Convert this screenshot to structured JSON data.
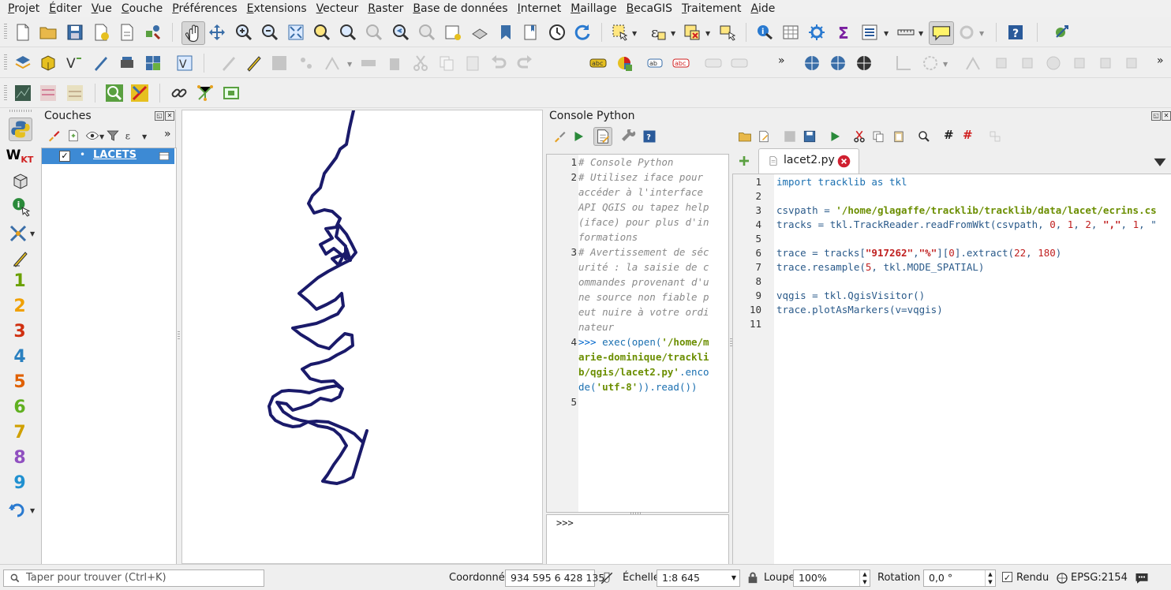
{
  "menubar": {
    "items": [
      {
        "label": "Projet",
        "accel": "P",
        "rest": "rojet"
      },
      {
        "label": "Éditer",
        "accel": "É",
        "rest": "diter"
      },
      {
        "label": "Vue",
        "accel": "V",
        "rest": "ue"
      },
      {
        "label": "Couche",
        "accel": "C",
        "rest": "ouche"
      },
      {
        "label": "Préférences",
        "accel": "P",
        "rest": "références"
      },
      {
        "label": "Extensions",
        "accel": "E",
        "rest": "xtensions"
      },
      {
        "label": "Vecteur",
        "accel": "V",
        "rest": "ecteur"
      },
      {
        "label": "Raster",
        "accel": "R",
        "rest": "aster"
      },
      {
        "label": "Base de données",
        "accel": "B",
        "rest": "ase de données"
      },
      {
        "label": "Internet",
        "accel": "I",
        "rest": "nternet"
      },
      {
        "label": "Maillage",
        "accel": "M",
        "rest": "aillage"
      },
      {
        "label": "BecaGIS",
        "accel": "B",
        "rest": "ecaGIS"
      },
      {
        "label": "Traitement",
        "accel": "T",
        "rest": "raitement"
      },
      {
        "label": "Aide",
        "accel": "A",
        "rest": "ide"
      }
    ]
  },
  "layers_panel": {
    "title": "Couches",
    "layer_name": "LACETS",
    "layer_checked": "✓",
    "layer_bullet": "•"
  },
  "left_toolbar": {
    "numbers": [
      "1",
      "2",
      "3",
      "4",
      "5",
      "6",
      "7",
      "8",
      "9"
    ],
    "number_colors": [
      "#6aa000",
      "#f0a000",
      "#d03010",
      "#2a80c0",
      "#e06000",
      "#60b020",
      "#d0a000",
      "#9050c0",
      "#2090d0"
    ],
    "wkt_label": "W"
  },
  "console": {
    "title": "Console Python",
    "lines": [
      {
        "n": "1",
        "text": "# Console Python"
      },
      {
        "n": "2",
        "text": "# Utilisez iface pour accéder à l'interface API QGIS ou tapez help(iface) pour plus d'informations"
      },
      {
        "n": "3",
        "text": "# Avertissement de sécurité : la saisie de commandes provenant d'une source non fiable peut nuire à votre ordinateur"
      },
      {
        "n": "4",
        "prompt": ">>>",
        "call": "exec(open(",
        "path": "'/home/marie-dominique/tracklib/qgis/lacet2.py'",
        "tail1": ".encode(",
        "enc": "'utf-8'",
        "tail2": ")).read())"
      },
      {
        "n": "5",
        "text": ""
      }
    ],
    "wrapped": {
      "l1": [
        "# Console Python"
      ],
      "l2": [
        "# Utilisez iface pour",
        "accéder à l'interface",
        "API QGIS ou tapez help",
        "(iface) pour plus d'in",
        "formations"
      ],
      "l3": [
        "# Avertissement de séc",
        "urité : la saisie de c",
        "ommandes provenant d'u",
        "ne source non fiable p",
        "eut nuire à votre ordi",
        "nateur"
      ],
      "l4a": ">>> ",
      "l4b": "exec(open(",
      "l4c": "'/home/m",
      "l4d": "arie-dominique/trackli",
      "l4e": "b/qgis/lacet2.py'",
      "l4f": ".enco",
      "l4g": "de(",
      "l4h": "'utf-8'",
      "l4i": ")).read())"
    },
    "input_prompt": ">>>"
  },
  "editor": {
    "tab_label": "lacet2.py",
    "lines": [
      {
        "n": "1"
      },
      {
        "n": "2"
      },
      {
        "n": "3"
      },
      {
        "n": "4"
      },
      {
        "n": "5"
      },
      {
        "n": "6"
      },
      {
        "n": "7"
      },
      {
        "n": "8"
      },
      {
        "n": "9"
      },
      {
        "n": "10"
      },
      {
        "n": "11"
      }
    ],
    "code": {
      "l1": "import tracklib as tkl",
      "l3a": "csvpath = ",
      "l3b": "'/home/glagaffe/tracklib/tracklib/data/lacet/ecrins.cs",
      "l4a": "tracks = tkl.TrackReader.readFromWkt(csvpath, ",
      "l4b": "0",
      "l4c": ", ",
      "l4d": "1",
      "l4e": ", ",
      "l4f": "2",
      "l4g": ", ",
      "l4h": "\",\"",
      "l4i": ", ",
      "l4j": "1",
      "l4k": ", \"",
      "l6a": "trace = tracks[",
      "l6b": "\"917262\"",
      "l6c": ",",
      "l6d": "\"%\"",
      "l6e": "][",
      "l6f": "0",
      "l6g": "].extract(",
      "l6h": "22",
      "l6i": ", ",
      "l6j": "180",
      "l6k": ")",
      "l7a": "trace.resample(",
      "l7b": "5",
      "l7c": ", tkl.MODE_SPATIAL)",
      "l9": "vqgis = tkl.QgisVisitor()",
      "l10": "trace.plotAsMarkers(v=vqgis)"
    }
  },
  "statusbar": {
    "search_placeholder": "Taper pour trouver (Ctrl+K)",
    "coord_label": "Coordonnée",
    "coord_value": "934 595 6 428 135",
    "scale_label": "Échelle",
    "scale_value": "1:8 645",
    "magnifier_label": "Loupe",
    "magnifier_value": "100%",
    "rotation_label": "Rotation",
    "rotation_value": "0,0 °",
    "render_label": "Rendu",
    "render_checked": "✓",
    "crs_label": "EPSG:2154"
  },
  "colors": {
    "track": "#1a1a6a",
    "selection": "#3d8ad4"
  }
}
